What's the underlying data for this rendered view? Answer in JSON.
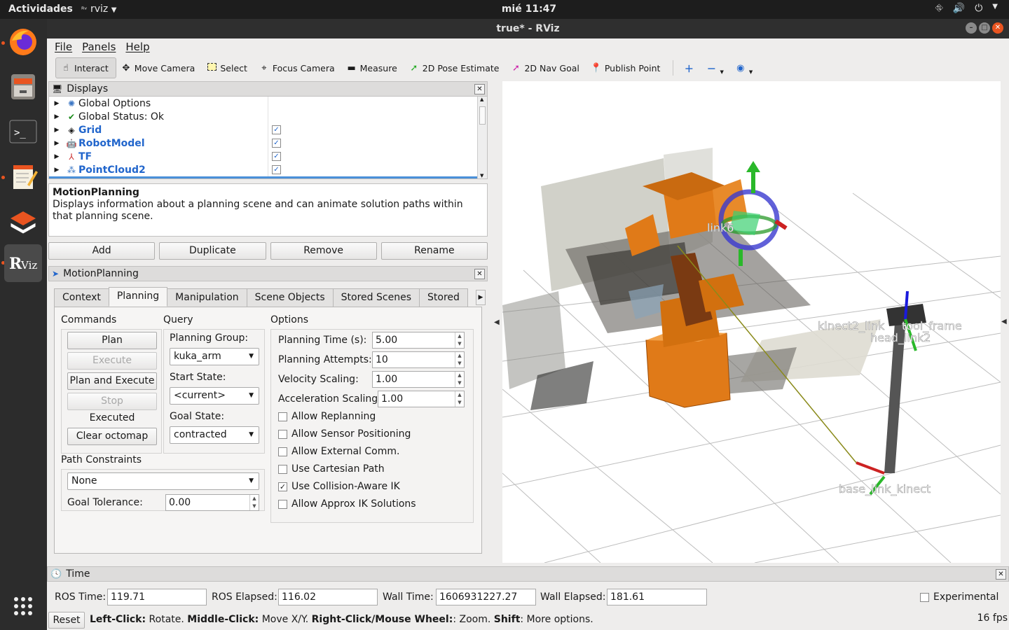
{
  "system": {
    "activities": "Actividades",
    "app_menu": "rviz",
    "clock": "mié 11:47"
  },
  "window": {
    "title": "true* - RViz",
    "menu": [
      "File",
      "Panels",
      "Help"
    ]
  },
  "toolbar": {
    "tools": [
      {
        "label": "Interact",
        "icon": "hand-icon"
      },
      {
        "label": "Move Camera",
        "icon": "move-camera-icon"
      },
      {
        "label": "Select",
        "icon": "select-icon"
      },
      {
        "label": "Focus Camera",
        "icon": "focus-camera-icon"
      },
      {
        "label": "Measure",
        "icon": "measure-icon"
      },
      {
        "label": "2D Pose Estimate",
        "icon": "pose-estimate-icon"
      },
      {
        "label": "2D Nav Goal",
        "icon": "nav-goal-icon"
      },
      {
        "label": "Publish Point",
        "icon": "publish-point-icon"
      }
    ]
  },
  "displays": {
    "title": "Displays",
    "items": [
      {
        "label": "Global Options",
        "checked": null
      },
      {
        "label": "Global Status: Ok",
        "checked": null
      },
      {
        "label": "Grid",
        "checked": true
      },
      {
        "label": "RobotModel",
        "checked": true
      },
      {
        "label": "TF",
        "checked": true
      },
      {
        "label": "PointCloud2",
        "checked": true
      }
    ],
    "description_title": "MotionPlanning",
    "description_text": "Displays information about a planning scene and can animate solution paths within that planning scene.",
    "buttons": [
      "Add",
      "Duplicate",
      "Remove",
      "Rename"
    ]
  },
  "motion_planning": {
    "title": "MotionPlanning",
    "tabs": [
      "Context",
      "Planning",
      "Manipulation",
      "Scene Objects",
      "Stored Scenes",
      "Stored"
    ],
    "commands": {
      "title": "Commands",
      "plan": "Plan",
      "execute": "Execute",
      "plan_execute": "Plan and Execute",
      "stop": "Stop",
      "status": "Executed",
      "clear_octomap": "Clear octomap"
    },
    "query": {
      "title": "Query",
      "planning_group_label": "Planning Group:",
      "planning_group": "kuka_arm",
      "start_state_label": "Start State:",
      "start_state": "<current>",
      "goal_state_label": "Goal State:",
      "goal_state": "contracted"
    },
    "options": {
      "title": "Options",
      "planning_time_label": "Planning Time (s):",
      "planning_time": "5.00",
      "planning_attempts_label": "Planning Attempts:",
      "planning_attempts": "10",
      "velocity_scaling_label": "Velocity Scaling:",
      "velocity_scaling": "1.00",
      "acceleration_scaling_label": "Acceleration Scaling:",
      "acceleration_scaling": "1.00",
      "checkboxes": [
        {
          "label": "Allow Replanning",
          "checked": false
        },
        {
          "label": "Allow Sensor Positioning",
          "checked": false
        },
        {
          "label": "Allow External Comm.",
          "checked": false
        },
        {
          "label": "Use Cartesian Path",
          "checked": false
        },
        {
          "label": "Use Collision-Aware IK",
          "checked": true
        },
        {
          "label": "Allow Approx IK Solutions",
          "checked": false
        }
      ]
    },
    "path_constraints": {
      "title": "Path Constraints",
      "value": "None",
      "goal_tolerance_label": "Goal Tolerance:",
      "goal_tolerance": "0.00"
    }
  },
  "view3d": {
    "frame_labels": [
      "kinect2_link",
      "tool_frame",
      "head_link2",
      "base_link_kinect",
      "link6"
    ]
  },
  "time": {
    "title": "Time",
    "ros_time_label": "ROS Time:",
    "ros_time": "119.71",
    "ros_elapsed_label": "ROS Elapsed:",
    "ros_elapsed": "116.02",
    "wall_time_label": "Wall Time:",
    "wall_time": "1606931227.27",
    "wall_elapsed_label": "Wall Elapsed:",
    "wall_elapsed": "181.61",
    "experimental_label": "Experimental",
    "experimental": false
  },
  "status": {
    "reset": "Reset",
    "hint_bold1": "Left-Click:",
    "hint1": " Rotate. ",
    "hint_bold2": "Middle-Click:",
    "hint2": " Move X/Y. ",
    "hint_bold3": "Right-Click/Mouse Wheel:",
    "hint3": ": Zoom. ",
    "hint_bold4": "Shift",
    "hint4": ": More options.",
    "fps": "16 fps"
  },
  "colors": {
    "ubuntu_orange": "#e95420",
    "robot_orange": "#e07a18",
    "link_blue": "#2266cc"
  }
}
